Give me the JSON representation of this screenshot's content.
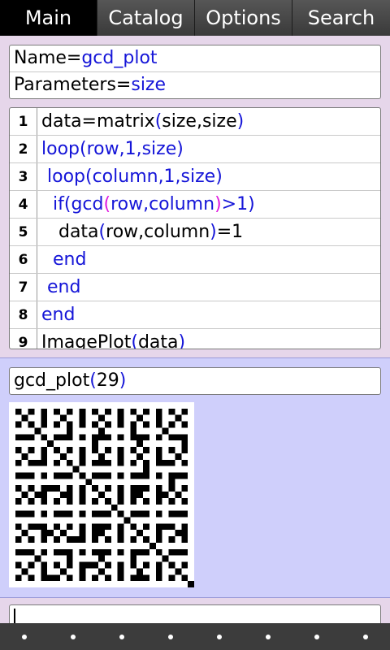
{
  "tabs": [
    "Main",
    "Catalog",
    "Options",
    "Search"
  ],
  "active_tab": 0,
  "definition": {
    "name_label": "Name=",
    "name_value": "gcd_plot",
    "params_label": "Parameters=",
    "params_value": "size"
  },
  "code_lines": [
    {
      "num": "1",
      "segments": [
        [
          "k",
          "data=matrix"
        ],
        [
          "b",
          "("
        ],
        [
          "k",
          "size,size"
        ],
        [
          "b",
          ")"
        ]
      ]
    },
    {
      "num": "2",
      "segments": [
        [
          "b",
          "loop(row,1,size)"
        ]
      ]
    },
    {
      "num": "3",
      "segments": [
        [
          "k",
          " "
        ],
        [
          "b",
          "loop(column,1,size)"
        ]
      ]
    },
    {
      "num": "4",
      "segments": [
        [
          "k",
          "  "
        ],
        [
          "b",
          "if(gcd"
        ],
        [
          "m",
          "("
        ],
        [
          "b",
          "row,column"
        ],
        [
          "m",
          ")"
        ],
        [
          "b",
          ">1)"
        ]
      ]
    },
    {
      "num": "5",
      "segments": [
        [
          "k",
          "   data"
        ],
        [
          "b",
          "("
        ],
        [
          "k",
          "row,column"
        ],
        [
          "b",
          ")"
        ],
        [
          "k",
          "=1"
        ]
      ]
    },
    {
      "num": "6",
      "segments": [
        [
          "k",
          "  "
        ],
        [
          "b",
          "end"
        ]
      ]
    },
    {
      "num": "7",
      "segments": [
        [
          "k",
          " "
        ],
        [
          "b",
          "end"
        ]
      ]
    },
    {
      "num": "8",
      "segments": [
        [
          "b",
          "end"
        ]
      ]
    },
    {
      "num": "9",
      "segments": [
        [
          "k",
          "ImagePlot"
        ],
        [
          "b",
          "("
        ],
        [
          "k",
          "data"
        ],
        [
          "b",
          ")"
        ]
      ]
    }
  ],
  "command": {
    "func": "gcd_plot",
    "open": "(",
    "arg": "29",
    "close": ")"
  },
  "plot": {
    "size": 29,
    "fg_color": "#ffffff",
    "bg_color": "#000000"
  },
  "input_value": "",
  "keyboard_dot_count": 8,
  "colors": {
    "keyword_blue": "#1515d8",
    "paren_magenta": "#e01ae0",
    "code_panel_bg": "#e6d6ea",
    "output_panel_bg": "#cfcffb"
  }
}
